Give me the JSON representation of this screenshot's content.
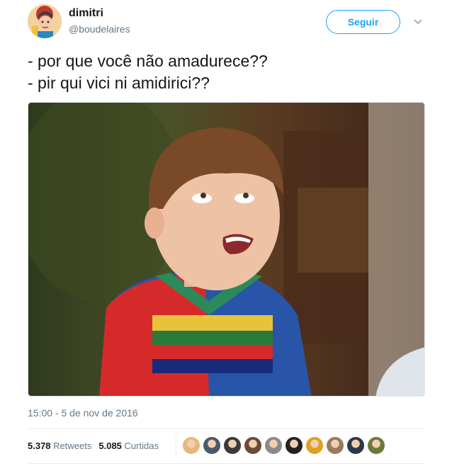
{
  "author": {
    "name": "dimitri",
    "handle": "@boudelaires",
    "avatar_icon": "avatar-cartoon-icon"
  },
  "follow_label": "Seguir",
  "tweet": {
    "line1": "- por que você não amadurece??",
    "line2": "- pir qui vici ni amidirici??"
  },
  "timestamp": "15:00 - 5 de nov de 2016",
  "stats": {
    "retweets_count": "5.378",
    "retweets_label": "Retweets",
    "likes_count": "5.085",
    "likes_label": "Curtidas"
  },
  "likers": [
    {
      "color": "#e8b77a"
    },
    {
      "color": "#4a5a6a"
    },
    {
      "color": "#3a3a3a"
    },
    {
      "color": "#6b4a3a"
    },
    {
      "color": "#8a8a8a"
    },
    {
      "color": "#222222"
    },
    {
      "color": "#e0a020"
    },
    {
      "color": "#9a7a5a"
    },
    {
      "color": "#2a3a4a"
    },
    {
      "color": "#6a7a3a"
    }
  ],
  "colors": {
    "accent": "#1da1f2",
    "text": "#14171a",
    "muted": "#657786"
  }
}
